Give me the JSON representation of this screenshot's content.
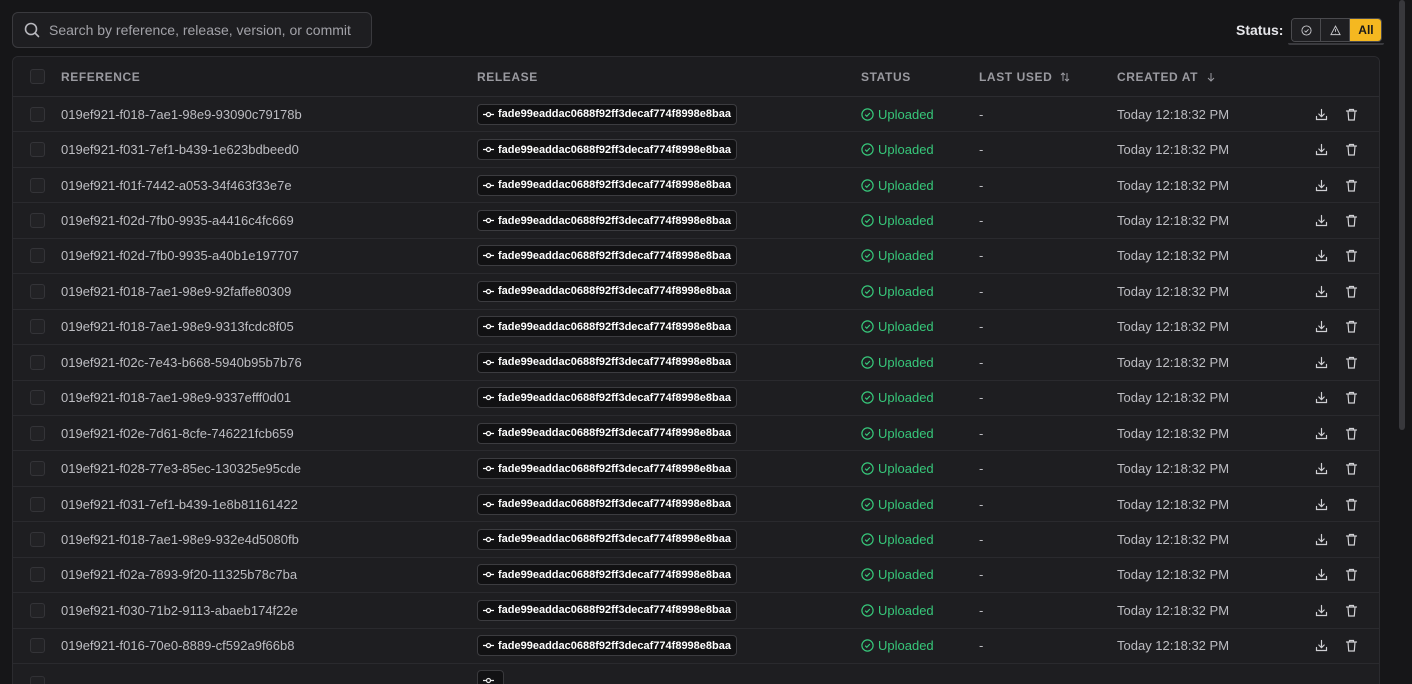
{
  "search": {
    "placeholder": "Search by reference, release, version, or commit"
  },
  "status_filter": {
    "label": "Status:",
    "options": [
      {
        "icon": "check-circle-icon"
      },
      {
        "icon": "warning-icon"
      },
      {
        "label": "All",
        "selected": true
      }
    ]
  },
  "table": {
    "columns": {
      "reference": "REFERENCE",
      "release": "RELEASE",
      "status": "STATUS",
      "last_used": "LAST USED",
      "created_at": "CREATED AT"
    },
    "rows": [
      {
        "reference": "019ef921-f018-7ae1-98e9-93090c79178b",
        "release": "fade99eaddac0688f92ff3decaf774f8998e8baa",
        "status": "Uploaded",
        "last_used": "-",
        "created_at": "Today 12:18:32 PM"
      },
      {
        "reference": "019ef921-f031-7ef1-b439-1e623bdbeed0",
        "release": "fade99eaddac0688f92ff3decaf774f8998e8baa",
        "status": "Uploaded",
        "last_used": "-",
        "created_at": "Today 12:18:32 PM"
      },
      {
        "reference": "019ef921-f01f-7442-a053-34f463f33e7e",
        "release": "fade99eaddac0688f92ff3decaf774f8998e8baa",
        "status": "Uploaded",
        "last_used": "-",
        "created_at": "Today 12:18:32 PM"
      },
      {
        "reference": "019ef921-f02d-7fb0-9935-a4416c4fc669",
        "release": "fade99eaddac0688f92ff3decaf774f8998e8baa",
        "status": "Uploaded",
        "last_used": "-",
        "created_at": "Today 12:18:32 PM"
      },
      {
        "reference": "019ef921-f02d-7fb0-9935-a40b1e197707",
        "release": "fade99eaddac0688f92ff3decaf774f8998e8baa",
        "status": "Uploaded",
        "last_used": "-",
        "created_at": "Today 12:18:32 PM"
      },
      {
        "reference": "019ef921-f018-7ae1-98e9-92faffe80309",
        "release": "fade99eaddac0688f92ff3decaf774f8998e8baa",
        "status": "Uploaded",
        "last_used": "-",
        "created_at": "Today 12:18:32 PM"
      },
      {
        "reference": "019ef921-f018-7ae1-98e9-9313fcdc8f05",
        "release": "fade99eaddac0688f92ff3decaf774f8998e8baa",
        "status": "Uploaded",
        "last_used": "-",
        "created_at": "Today 12:18:32 PM"
      },
      {
        "reference": "019ef921-f02c-7e43-b668-5940b95b7b76",
        "release": "fade99eaddac0688f92ff3decaf774f8998e8baa",
        "status": "Uploaded",
        "last_used": "-",
        "created_at": "Today 12:18:32 PM"
      },
      {
        "reference": "019ef921-f018-7ae1-98e9-9337efff0d01",
        "release": "fade99eaddac0688f92ff3decaf774f8998e8baa",
        "status": "Uploaded",
        "last_used": "-",
        "created_at": "Today 12:18:32 PM"
      },
      {
        "reference": "019ef921-f02e-7d61-8cfe-746221fcb659",
        "release": "fade99eaddac0688f92ff3decaf774f8998e8baa",
        "status": "Uploaded",
        "last_used": "-",
        "created_at": "Today 12:18:32 PM"
      },
      {
        "reference": "019ef921-f028-77e3-85ec-130325e95cde",
        "release": "fade99eaddac0688f92ff3decaf774f8998e8baa",
        "status": "Uploaded",
        "last_used": "-",
        "created_at": "Today 12:18:32 PM"
      },
      {
        "reference": "019ef921-f031-7ef1-b439-1e8b81161422",
        "release": "fade99eaddac0688f92ff3decaf774f8998e8baa",
        "status": "Uploaded",
        "last_used": "-",
        "created_at": "Today 12:18:32 PM"
      },
      {
        "reference": "019ef921-f018-7ae1-98e9-932e4d5080fb",
        "release": "fade99eaddac0688f92ff3decaf774f8998e8baa",
        "status": "Uploaded",
        "last_used": "-",
        "created_at": "Today 12:18:32 PM"
      },
      {
        "reference": "019ef921-f02a-7893-9f20-11325b78c7ba",
        "release": "fade99eaddac0688f92ff3decaf774f8998e8baa",
        "status": "Uploaded",
        "last_used": "-",
        "created_at": "Today 12:18:32 PM"
      },
      {
        "reference": "019ef921-f030-71b2-9113-abaeb174f22e",
        "release": "fade99eaddac0688f92ff3decaf774f8998e8baa",
        "status": "Uploaded",
        "last_used": "-",
        "created_at": "Today 12:18:32 PM"
      },
      {
        "reference": "019ef921-f016-70e0-8889-cf592a9f66b8",
        "release": "fade99eaddac0688f92ff3decaf774f8998e8baa",
        "status": "Uploaded",
        "last_used": "-",
        "created_at": "Today 12:18:32 PM"
      }
    ]
  },
  "colors": {
    "accent": "#f5b820",
    "status_uploaded": "#37c77a",
    "background": "#161618"
  }
}
